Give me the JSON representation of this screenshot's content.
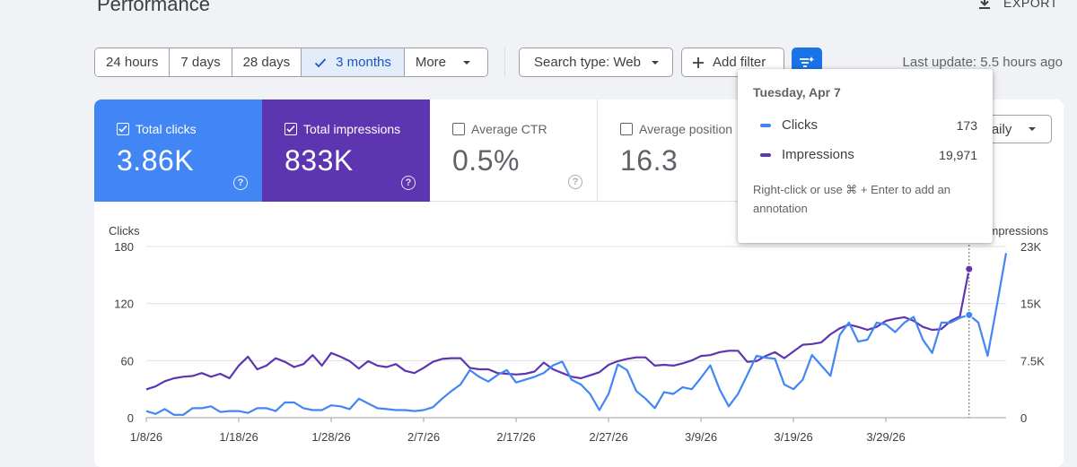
{
  "page": {
    "title": "Performance",
    "export_label": "EXPORT"
  },
  "toolbar": {
    "ranges": [
      "24 hours",
      "7 days",
      "28 days",
      "3 months"
    ],
    "more_label": "More",
    "search_type_label": "Search type: Web",
    "add_filter_label": "Add filter",
    "last_update": "Last update: 5.5 hours ago"
  },
  "metrics": {
    "clicks": {
      "label": "Total clicks",
      "value": "3.86K",
      "checked": true,
      "color": "#4285f4"
    },
    "impressions": {
      "label": "Total impressions",
      "value": "833K",
      "checked": true,
      "color": "#5e35b1"
    },
    "ctr": {
      "label": "Average CTR",
      "value": "0.5%",
      "checked": false
    },
    "position": {
      "label": "Average position",
      "value": "16.3",
      "checked": false
    }
  },
  "granularity": "Daily",
  "tooltip": {
    "date": "Tuesday, Apr 7",
    "rows": [
      {
        "name": "Clicks",
        "value": "173",
        "color": "#4285f4"
      },
      {
        "name": "Impressions",
        "value": "19,971",
        "color": "#5e35b1"
      }
    ],
    "note": "Right-click or use ⌘ + Enter to add an annotation"
  },
  "chart_data": {
    "type": "line",
    "x_tick_labels": [
      "1/8/26",
      "1/18/26",
      "1/28/26",
      "2/7/26",
      "2/17/26",
      "2/27/26",
      "3/9/26",
      "3/19/26",
      "3/29/26"
    ],
    "left_axis": {
      "label": "Clicks",
      "ticks": [
        "180",
        "120",
        "60",
        "0"
      ],
      "range": [
        0,
        180
      ]
    },
    "right_axis": {
      "label": "Impressions",
      "ticks": [
        "23K",
        "15K",
        "7.5K",
        "0"
      ],
      "range": [
        0,
        23000
      ]
    },
    "grid": true,
    "highlight_index": 89,
    "series": [
      {
        "name": "Clicks",
        "axis": "left",
        "color": "#4285f4",
        "values": [
          7,
          4,
          9,
          3,
          3,
          10,
          10,
          12,
          6,
          7,
          7,
          5,
          10,
          10,
          7,
          16,
          16,
          10,
          8,
          8,
          13,
          12,
          9,
          20,
          15,
          10,
          9,
          8,
          8,
          7,
          8,
          11,
          20,
          28,
          35,
          50,
          43,
          38,
          45,
          50,
          37,
          40,
          43,
          47,
          55,
          59,
          40,
          35,
          25,
          8,
          25,
          56,
          50,
          28,
          20,
          10,
          27,
          25,
          32,
          30,
          42,
          55,
          30,
          12,
          25,
          45,
          65,
          63,
          62,
          35,
          30,
          40,
          66,
          55,
          44,
          87,
          100,
          80,
          82,
          100,
          98,
          90,
          100,
          106,
          82,
          68,
          100,
          100,
          105,
          108,
          100,
          65,
          118,
          173
        ]
      },
      {
        "name": "Impressions",
        "axis": "right",
        "color": "#5e35b1",
        "values": [
          3800,
          4200,
          4900,
          5300,
          5500,
          5600,
          6000,
          5500,
          5900,
          5300,
          7000,
          8200,
          6500,
          7000,
          8000,
          7500,
          6800,
          7200,
          8400,
          7000,
          8700,
          8200,
          7600,
          6600,
          7600,
          7000,
          6800,
          7200,
          6300,
          6000,
          6700,
          7500,
          7900,
          8000,
          8000,
          6700,
          6500,
          6500,
          6000,
          5900,
          5800,
          5900,
          6200,
          7400,
          6500,
          6000,
          5500,
          5300,
          5700,
          6100,
          7100,
          7600,
          7900,
          8100,
          8100,
          7000,
          7100,
          7000,
          7300,
          7700,
          8300,
          8400,
          8800,
          9000,
          9000,
          7500,
          7600,
          8300,
          8800,
          8000,
          8900,
          9800,
          9900,
          10100,
          11200,
          12000,
          12500,
          12200,
          11800,
          12200,
          13000,
          13300,
          13500,
          13000,
          12200,
          11800,
          11900,
          13000,
          13600,
          19971
        ]
      }
    ]
  }
}
